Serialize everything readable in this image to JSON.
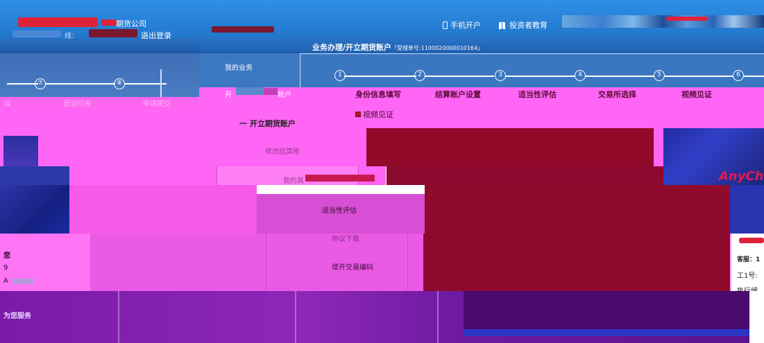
{
  "header": {
    "company_name": "期货公司",
    "hotline_label": "线：",
    "logout_label": "退出登录",
    "mobile_open_label": "手机开户",
    "investor_edu_label": "投资者教育"
  },
  "title_bar": {
    "title": "业务办理/开立期货账户",
    "ticket": "「受理单号:1100020000010164」"
  },
  "left_panel": {
    "old_steps": [
      "⑦",
      "⑧"
    ],
    "old_step_labels": [
      "议",
      "回访问卷",
      "申请提交"
    ],
    "text_lines": [
      "您",
      "9",
      "A"
    ],
    "bottom_text": "为您服务"
  },
  "menu": {
    "my_business": "我的业务",
    "open_account_partial": "开",
    "open_account_suffix": "账户",
    "open_futures_account": "一  开立期货账户",
    "modify_settlement": "修改结算账户",
    "my_other": "我的其",
    "suitability": "适当性评估",
    "agreement_download": "协议下载",
    "add_trade_code": "增开交易编码"
  },
  "steps": {
    "numbers": [
      "1",
      "2",
      "3",
      "4",
      "5",
      "6"
    ],
    "labels": [
      "身份信息填写",
      "结算账户设置",
      "适当性评估",
      "交易所选择",
      "视频见证"
    ]
  },
  "section": {
    "title": "视频见证"
  },
  "video": {
    "brand": "AnyCh"
  },
  "right_panel": {
    "service_label": "客服：1",
    "line2": "工1号:",
    "exec_label": "执行编号"
  },
  "colors": {
    "header_blue": "#2277cc",
    "glitch_pink": "#ff66f5",
    "video_red": "#920a2a",
    "bottom_purple": "#7a1aa8"
  }
}
